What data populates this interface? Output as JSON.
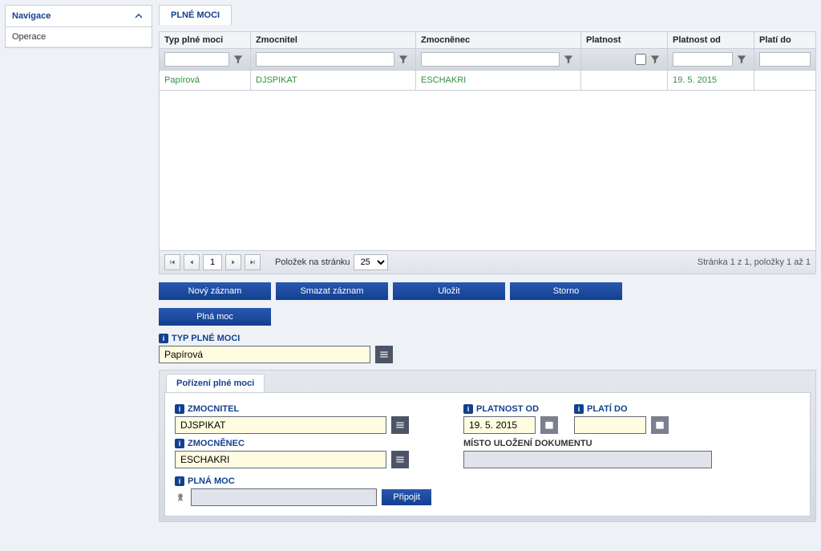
{
  "sidebar": {
    "nav_label": "Navigace",
    "ops_label": "Operace"
  },
  "tab": {
    "label": "PLNÉ MOCI"
  },
  "grid": {
    "headers": {
      "typ": "Typ plné moci",
      "zmocnitel": "Zmocnitel",
      "zmocnenec": "Zmocněnec",
      "platnost": "Platnost",
      "platnost_od": "Platnost od",
      "plati_do": "Platí do"
    },
    "row": {
      "typ": "Papírová",
      "zmocnitel": "DJSPIKAT",
      "zmocnenec": "ESCHAKRI",
      "platnost": "",
      "platnost_od": "19. 5. 2015",
      "plati_do": ""
    }
  },
  "pager": {
    "page": "1",
    "label": "Položek na stránku",
    "per_page": "25",
    "summary": "Stránka 1 z 1, položky 1 až 1"
  },
  "actions": {
    "new": "Nový záznam",
    "delete": "Smazat záznam",
    "save": "Uložit",
    "cancel": "Storno"
  },
  "section": {
    "title": "Plná moc"
  },
  "form": {
    "typ_label": "TYP PLNÉ MOCI",
    "typ_value": "Papírová",
    "sub_tab": "Pořízení plné moci",
    "zmocnitel_label": "ZMOCNITEL",
    "zmocnitel_value": "DJSPIKAT",
    "zmocnenec_label": "ZMOCNĚNEC",
    "zmocnenec_value": "ESCHAKRI",
    "plna_moc_label": "PLNÁ MOC",
    "platnost_od_label": "PLATNOST OD",
    "platnost_od_value": "19. 5. 2015",
    "plati_do_label": "PLATÍ DO",
    "plati_do_value": "",
    "misto_label": "MÍSTO ULOŽENÍ DOKUMENTU",
    "misto_value": "",
    "pripojit": "Připojit"
  }
}
